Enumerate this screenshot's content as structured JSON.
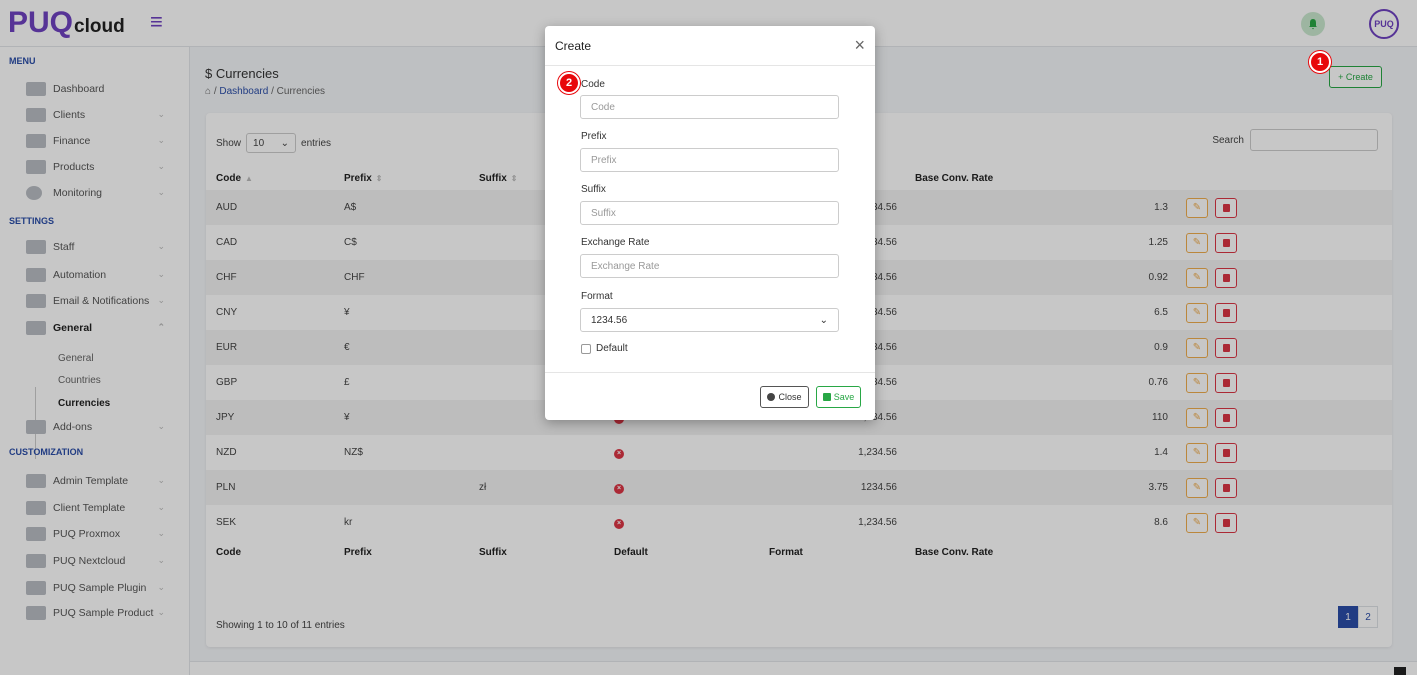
{
  "brand": {
    "name_main": "PUQ",
    "name_suffix": "cloud",
    "avatar_text": "PUQ"
  },
  "sidebar": {
    "menu_title": "MENU",
    "settings_title": "SETTINGS",
    "customization_title": "CUSTOMIZATION",
    "items": [
      {
        "label": "Dashboard",
        "icon": "chart-icon"
      },
      {
        "label": "Clients",
        "icon": "users-icon"
      },
      {
        "label": "Finance",
        "icon": "finance-icon"
      },
      {
        "label": "Products",
        "icon": "products-icon"
      },
      {
        "label": "Monitoring",
        "icon": "monitoring-icon"
      },
      {
        "label": "Staff",
        "icon": "staff-icon"
      },
      {
        "label": "Automation",
        "icon": "robot-icon"
      },
      {
        "label": "Email & Notifications",
        "icon": "email-icon"
      },
      {
        "label": "General",
        "icon": "tools-icon"
      },
      {
        "label": "Add-ons",
        "icon": "puzzle-icon"
      },
      {
        "label": "Admin Template",
        "icon": "template-icon"
      },
      {
        "label": "Client Template",
        "icon": "template-icon"
      },
      {
        "label": "PUQ Proxmox",
        "icon": "server-icon"
      },
      {
        "label": "PUQ Nextcloud",
        "icon": "box-icon"
      },
      {
        "label": "PUQ Sample Plugin",
        "icon": "briefcase-icon"
      },
      {
        "label": "PUQ Sample Product",
        "icon": "box-icon"
      }
    ],
    "general_sub": [
      "General",
      "Countries",
      "Currencies"
    ]
  },
  "page": {
    "title": "$ Currencies",
    "breadcrumb_link": "Dashboard",
    "breadcrumb_current": "Currencies",
    "create_label": "+ Create"
  },
  "table": {
    "show_label": "Show",
    "entries_label": "entries",
    "page_size": "10",
    "search_label": "Search",
    "headers": [
      "Code",
      "Prefix",
      "Suffix",
      "Default",
      "Format",
      "Base Conv. Rate"
    ],
    "rows": [
      {
        "code": "AUD",
        "prefix": "A$",
        "suffix": "",
        "format": "1,234.56",
        "rate": "1.3"
      },
      {
        "code": "CAD",
        "prefix": "C$",
        "suffix": "",
        "format": "1,234.56",
        "rate": "1.25"
      },
      {
        "code": "CHF",
        "prefix": "CHF",
        "suffix": "",
        "format": "1,234.56",
        "rate": "0.92"
      },
      {
        "code": "CNY",
        "prefix": "¥",
        "suffix": "",
        "format": "1,234.56",
        "rate": "6.5"
      },
      {
        "code": "EUR",
        "prefix": "€",
        "suffix": "",
        "format": "1,234.56",
        "rate": "0.9"
      },
      {
        "code": "GBP",
        "prefix": "£",
        "suffix": "",
        "format": "1,234.56",
        "rate": "0.76"
      },
      {
        "code": "JPY",
        "prefix": "¥",
        "suffix": "",
        "format": "1,234.56",
        "rate": "110"
      },
      {
        "code": "NZD",
        "prefix": "NZ$",
        "suffix": "",
        "format": "1,234.56",
        "rate": "1.4"
      },
      {
        "code": "PLN",
        "prefix": "",
        "suffix": "zł",
        "format": "1234.56",
        "rate": "3.75"
      },
      {
        "code": "SEK",
        "prefix": "kr",
        "suffix": "",
        "format": "1,234.56",
        "rate": "8.6"
      }
    ],
    "showing_text": "Showing 1 to 10 of 11 entries",
    "pages": [
      "1",
      "2"
    ]
  },
  "modal": {
    "title": "Create",
    "fields": [
      {
        "label": "Code",
        "placeholder": "Code"
      },
      {
        "label": "Prefix",
        "placeholder": "Prefix"
      },
      {
        "label": "Suffix",
        "placeholder": "Suffix"
      },
      {
        "label": "Exchange Rate",
        "placeholder": "Exchange Rate"
      }
    ],
    "format_label": "Format",
    "format_value": "1234.56",
    "default_label": "Default",
    "close_label": "Close",
    "save_label": "Save"
  },
  "markers": [
    "1",
    "2"
  ],
  "colors": {
    "brand": "#6f42c1",
    "primary": "#2b4ea8",
    "success": "#28a745",
    "danger": "#dc3545",
    "warning": "#f0ad4e",
    "marker": "#e8070b"
  }
}
